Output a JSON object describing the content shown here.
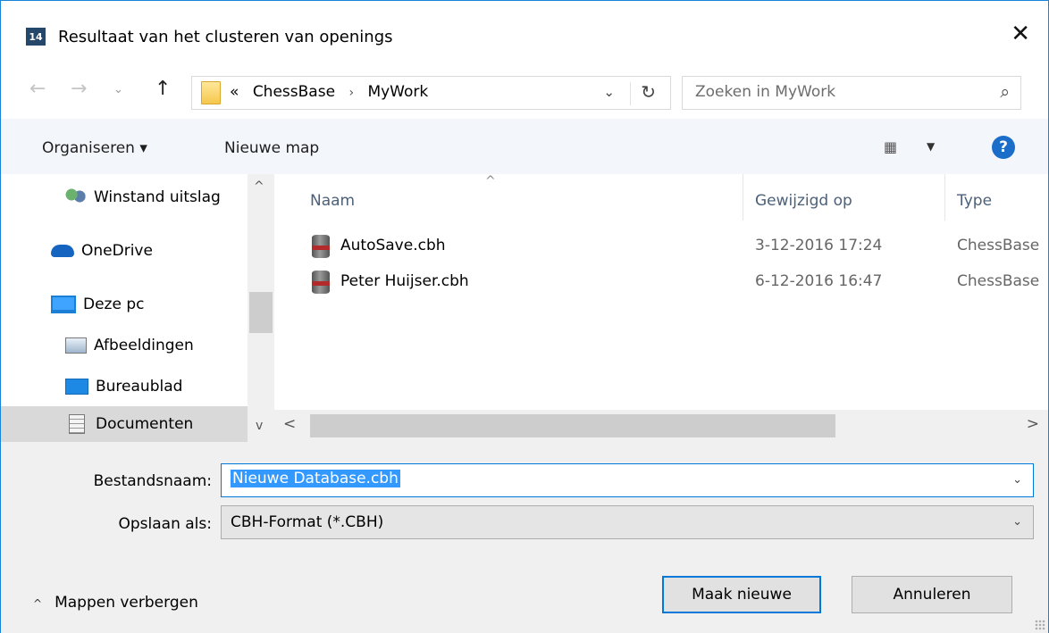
{
  "window": {
    "app_icon_text": "14",
    "title": "Resultaat van het clusteren van openings",
    "close_glyph": "✕"
  },
  "nav": {
    "back": "←",
    "forward": "→",
    "history": "⌄",
    "up": "↑",
    "breadcrumb_prefix": "«",
    "breadcrumbs": [
      "ChessBase",
      "MyWork"
    ],
    "address_dropdown": "⌄",
    "refresh": "↻",
    "search_placeholder": "Zoeken in MyWork",
    "search_icon": "⌕"
  },
  "toolbar": {
    "organize_label": "Organiseren ▾",
    "new_folder_label": "Nieuwe map",
    "view_icon": "▦",
    "view_chevron": "▼",
    "help": "?"
  },
  "sidebar": {
    "items": [
      {
        "label": "Winstand uitslag",
        "icon": "users-icon",
        "selected": false
      },
      {
        "label": "OneDrive",
        "icon": "cloud-icon",
        "selected": false
      },
      {
        "label": "Deze pc",
        "icon": "computer-icon",
        "selected": false
      },
      {
        "label": "Afbeeldingen",
        "icon": "pictures-icon",
        "selected": false
      },
      {
        "label": "Bureaublad",
        "icon": "desktop-icon",
        "selected": false
      },
      {
        "label": "Documenten",
        "icon": "documents-icon",
        "selected": true
      }
    ],
    "scroll_up": "^",
    "scroll_down": "v"
  },
  "filelist": {
    "columns": {
      "name": "Naam",
      "modified": "Gewijzigd op",
      "type": "Type"
    },
    "sort_caret": "^",
    "files": [
      {
        "name": "AutoSave.cbh",
        "modified": "3-12-2016 17:24",
        "type": "ChessBase"
      },
      {
        "name": "Peter Huijser.cbh",
        "modified": "6-12-2016 16:47",
        "type": "ChessBase"
      }
    ],
    "scroll_left": "<",
    "scroll_right": ">"
  },
  "form": {
    "filename_label": "Bestandsnaam:",
    "filename_value": "Nieuwe Database.cbh",
    "savetype_label": "Opslaan als:",
    "savetype_value": "CBH-Format (*.CBH)",
    "dropdown_glyph": "⌄"
  },
  "footer": {
    "hide_folders_caret": "^",
    "hide_folders_label": "Mappen verbergen",
    "ok_label": "Maak nieuwe",
    "cancel_label": "Annuleren"
  },
  "colors": {
    "accent": "#0078d7",
    "selection": "#3399ff",
    "help": "#1a6dc9"
  }
}
